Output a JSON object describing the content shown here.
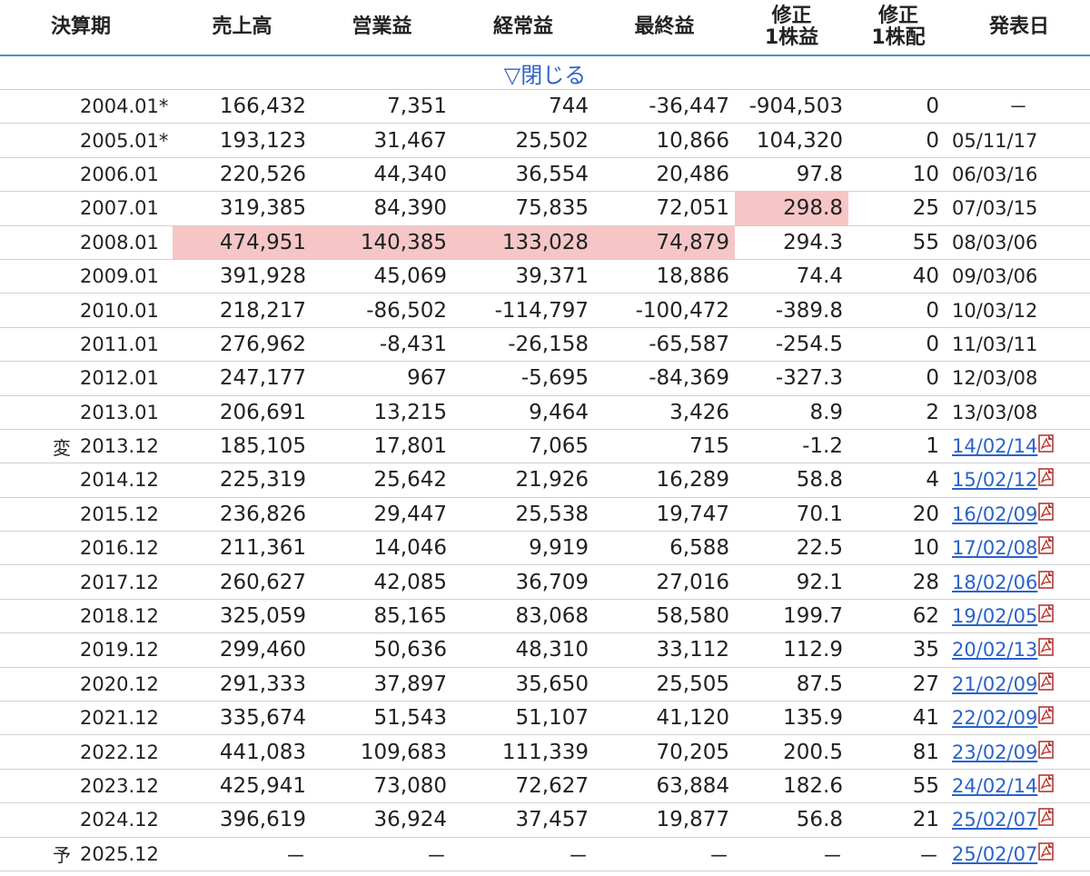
{
  "headers": {
    "period": "決算期",
    "sales": "売上高",
    "operating": "営業益",
    "ordinary": "経常益",
    "net": "最終益",
    "eps_line1": "修正",
    "eps_line2": "1株益",
    "div_line1": "修正",
    "div_line2": "1株配",
    "date": "発表日"
  },
  "toggle_label": "▽閉じる",
  "highlight_color": "#f6c6c6",
  "link_color": "#2b63c8",
  "icon": "pdf-icon",
  "rows": [
    {
      "mark": "",
      "period": "2004.01*",
      "sales": "166,432",
      "operating": "7,351",
      "ordinary": "744",
      "net": "-36,447",
      "eps": "-904,503",
      "div": "0",
      "date": "－",
      "link": false
    },
    {
      "mark": "",
      "period": "2005.01*",
      "sales": "193,123",
      "operating": "31,467",
      "ordinary": "25,502",
      "net": "10,866",
      "eps": "104,320",
      "div": "0",
      "date": "05/11/17",
      "link": false
    },
    {
      "mark": "",
      "period": "2006.01",
      "sales": "220,526",
      "operating": "44,340",
      "ordinary": "36,554",
      "net": "20,486",
      "eps": "97.8",
      "div": "10",
      "date": "06/03/16",
      "link": false
    },
    {
      "mark": "",
      "period": "2007.01",
      "sales": "319,385",
      "operating": "84,390",
      "ordinary": "75,835",
      "net": "72,051",
      "eps": "298.8",
      "div": "25",
      "date": "07/03/15",
      "link": false,
      "hl": [
        "eps"
      ]
    },
    {
      "mark": "",
      "period": "2008.01",
      "sales": "474,951",
      "operating": "140,385",
      "ordinary": "133,028",
      "net": "74,879",
      "eps": "294.3",
      "div": "55",
      "date": "08/03/06",
      "link": false,
      "hl": [
        "sales",
        "operating",
        "ordinary",
        "net"
      ]
    },
    {
      "mark": "",
      "period": "2009.01",
      "sales": "391,928",
      "operating": "45,069",
      "ordinary": "39,371",
      "net": "18,886",
      "eps": "74.4",
      "div": "40",
      "date": "09/03/06",
      "link": false
    },
    {
      "mark": "",
      "period": "2010.01",
      "sales": "218,217",
      "operating": "-86,502",
      "ordinary": "-114,797",
      "net": "-100,472",
      "eps": "-389.8",
      "div": "0",
      "date": "10/03/12",
      "link": false
    },
    {
      "mark": "",
      "period": "2011.01",
      "sales": "276,962",
      "operating": "-8,431",
      "ordinary": "-26,158",
      "net": "-65,587",
      "eps": "-254.5",
      "div": "0",
      "date": "11/03/11",
      "link": false
    },
    {
      "mark": "",
      "period": "2012.01",
      "sales": "247,177",
      "operating": "967",
      "ordinary": "-5,695",
      "net": "-84,369",
      "eps": "-327.3",
      "div": "0",
      "date": "12/03/08",
      "link": false
    },
    {
      "mark": "",
      "period": "2013.01",
      "sales": "206,691",
      "operating": "13,215",
      "ordinary": "9,464",
      "net": "3,426",
      "eps": "8.9",
      "div": "2",
      "date": "13/03/08",
      "link": false
    },
    {
      "mark": "変",
      "period": "2013.12",
      "sales": "185,105",
      "operating": "17,801",
      "ordinary": "7,065",
      "net": "715",
      "eps": "-1.2",
      "div": "1",
      "date": "14/02/14",
      "link": true
    },
    {
      "mark": "",
      "period": "2014.12",
      "sales": "225,319",
      "operating": "25,642",
      "ordinary": "21,926",
      "net": "16,289",
      "eps": "58.8",
      "div": "4",
      "date": "15/02/12",
      "link": true
    },
    {
      "mark": "",
      "period": "2015.12",
      "sales": "236,826",
      "operating": "29,447",
      "ordinary": "25,538",
      "net": "19,747",
      "eps": "70.1",
      "div": "20",
      "date": "16/02/09",
      "link": true
    },
    {
      "mark": "",
      "period": "2016.12",
      "sales": "211,361",
      "operating": "14,046",
      "ordinary": "9,919",
      "net": "6,588",
      "eps": "22.5",
      "div": "10",
      "date": "17/02/08",
      "link": true
    },
    {
      "mark": "",
      "period": "2017.12",
      "sales": "260,627",
      "operating": "42,085",
      "ordinary": "36,709",
      "net": "27,016",
      "eps": "92.1",
      "div": "28",
      "date": "18/02/06",
      "link": true
    },
    {
      "mark": "",
      "period": "2018.12",
      "sales": "325,059",
      "operating": "85,165",
      "ordinary": "83,068",
      "net": "58,580",
      "eps": "199.7",
      "div": "62",
      "date": "19/02/05",
      "link": true
    },
    {
      "mark": "",
      "period": "2019.12",
      "sales": "299,460",
      "operating": "50,636",
      "ordinary": "48,310",
      "net": "33,112",
      "eps": "112.9",
      "div": "35",
      "date": "20/02/13",
      "link": true
    },
    {
      "mark": "",
      "period": "2020.12",
      "sales": "291,333",
      "operating": "37,897",
      "ordinary": "35,650",
      "net": "25,505",
      "eps": "87.5",
      "div": "27",
      "date": "21/02/09",
      "link": true
    },
    {
      "mark": "",
      "period": "2021.12",
      "sales": "335,674",
      "operating": "51,543",
      "ordinary": "51,107",
      "net": "41,120",
      "eps": "135.9",
      "div": "41",
      "date": "22/02/09",
      "link": true
    },
    {
      "mark": "",
      "period": "2022.12",
      "sales": "441,083",
      "operating": "109,683",
      "ordinary": "111,339",
      "net": "70,205",
      "eps": "200.5",
      "div": "81",
      "date": "23/02/09",
      "link": true
    },
    {
      "mark": "",
      "period": "2023.12",
      "sales": "425,941",
      "operating": "73,080",
      "ordinary": "72,627",
      "net": "63,884",
      "eps": "182.6",
      "div": "55",
      "date": "24/02/14",
      "link": true
    },
    {
      "mark": "",
      "period": "2024.12",
      "sales": "396,619",
      "operating": "36,924",
      "ordinary": "37,457",
      "net": "19,877",
      "eps": "56.8",
      "div": "21",
      "date": "25/02/07",
      "link": true
    },
    {
      "mark": "予",
      "period": "2025.12",
      "sales": "－",
      "operating": "－",
      "ordinary": "－",
      "net": "－",
      "eps": "－",
      "div": "－",
      "date": "25/02/07",
      "link": true
    }
  ]
}
